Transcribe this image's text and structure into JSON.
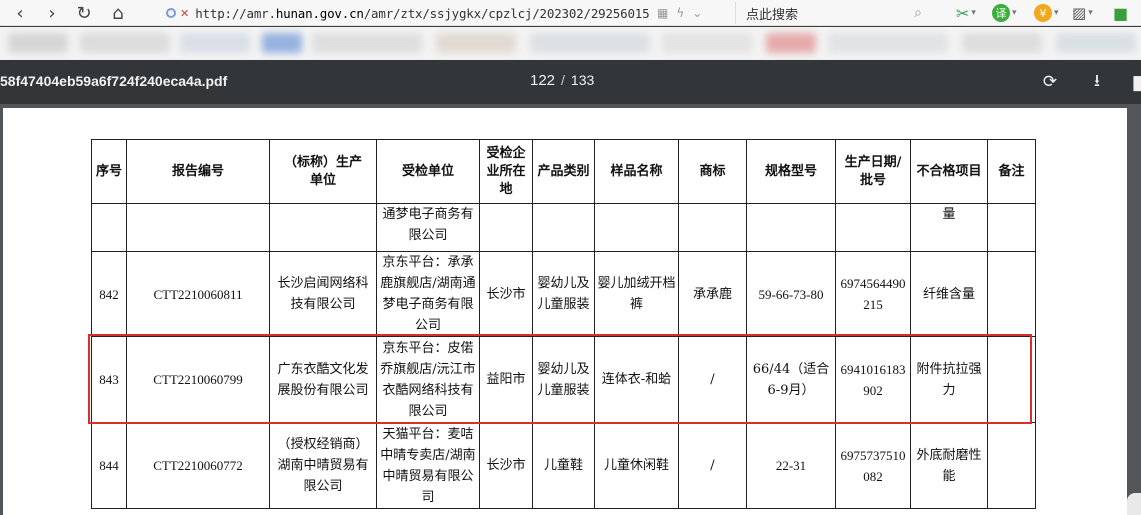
{
  "browser": {
    "url_prefix": "http://amr.",
    "url_domain": "hunan.gov.cn",
    "url_path": "/amr/ztx/ssjygkx/cpzlcj/202302/29256015",
    "search_placeholder": "点此搜索"
  },
  "pdf": {
    "filename": "58f47404eb59a6f724f240eca4a.pdf",
    "current_page": "122",
    "separator": "/",
    "total_pages": "133"
  },
  "table": {
    "headers": [
      "序号",
      "报告编号",
      "（标称）生产单位",
      "受检单位",
      "受检企业所在地",
      "产品类别",
      "样品名称",
      "商标",
      "规格型号",
      "生产日期/批号",
      "不合格项目",
      "备注"
    ],
    "continuation": {
      "inspected": "通梦电子商务有限公司",
      "failed_item": "量"
    },
    "rows": [
      {
        "no": "842",
        "report": "CTT2210060811",
        "producer": "长沙启闻网络科技有限公司",
        "inspected": "京东平台：承承鹿旗舰店/湖南通梦电子商务有限公司",
        "location": "长沙市",
        "category": "婴幼儿及儿童服装",
        "sample": "婴儿加绒开档裤",
        "brand": "承承鹿",
        "spec": "59-66-73-80",
        "batch": "6974564490215",
        "failed_item": "纤维含量",
        "note": ""
      },
      {
        "no": "843",
        "report": "CTT2210060799",
        "producer": "广东衣酷文化发展股份有限公司",
        "inspected": "京东平台：皮偌乔旗舰店/沅江市衣酷网络科技有限公司",
        "location": "益阳市",
        "category": "婴幼儿及儿童服装",
        "sample": "连体衣-和蛤",
        "brand": "/",
        "spec": "66/44（适合6-9月）",
        "batch": "6941016183902",
        "failed_item": "附件抗拉强力",
        "note": ""
      },
      {
        "no": "844",
        "report": "CTT2210060772",
        "producer": "（授权经销商）湖南中晴贸易有限公司",
        "inspected": "天猫平台：麦咭中晴专卖店/湖南中晴贸易有限公司",
        "location": "长沙市",
        "category": "儿童鞋",
        "sample": "儿童休闲鞋",
        "brand": "/",
        "spec": "22-31",
        "batch": "6975737510082",
        "failed_item": "外底耐磨性能",
        "note": ""
      }
    ]
  }
}
